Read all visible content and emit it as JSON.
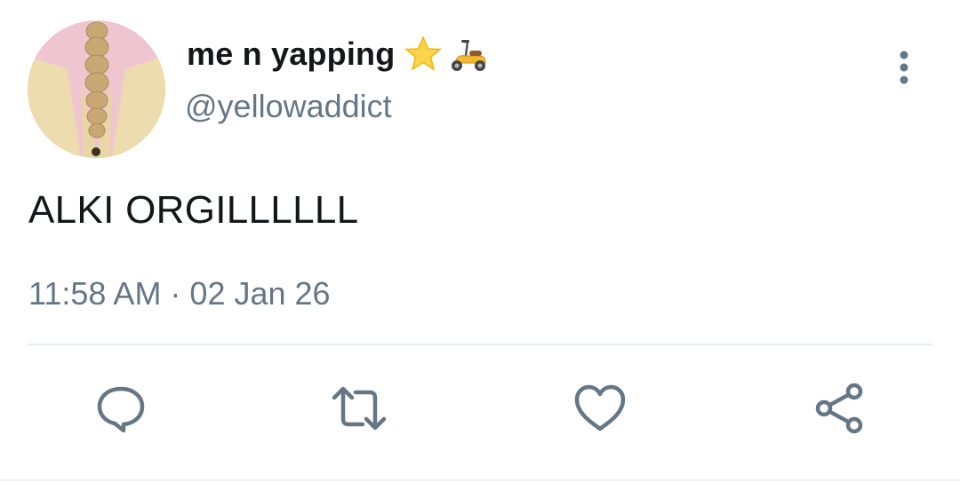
{
  "user": {
    "display_name": "me n yapping",
    "emojis": [
      "star-emoji",
      "motor-scooter-emoji"
    ],
    "handle": "@yellowaddict"
  },
  "tweet": {
    "text": "ALKI ORGILLLLLL",
    "timestamp": "11:58 AM · 02 Jan 26"
  },
  "actions": [
    {
      "name": "reply",
      "icon": "comment-icon"
    },
    {
      "name": "retweet",
      "icon": "retweet-icon"
    },
    {
      "name": "like",
      "icon": "heart-icon"
    },
    {
      "name": "share",
      "icon": "share-icon"
    }
  ],
  "colors": {
    "text_primary": "#14171a",
    "text_secondary": "#657786",
    "icon": "#657786",
    "divider": "#e6ecf0"
  }
}
